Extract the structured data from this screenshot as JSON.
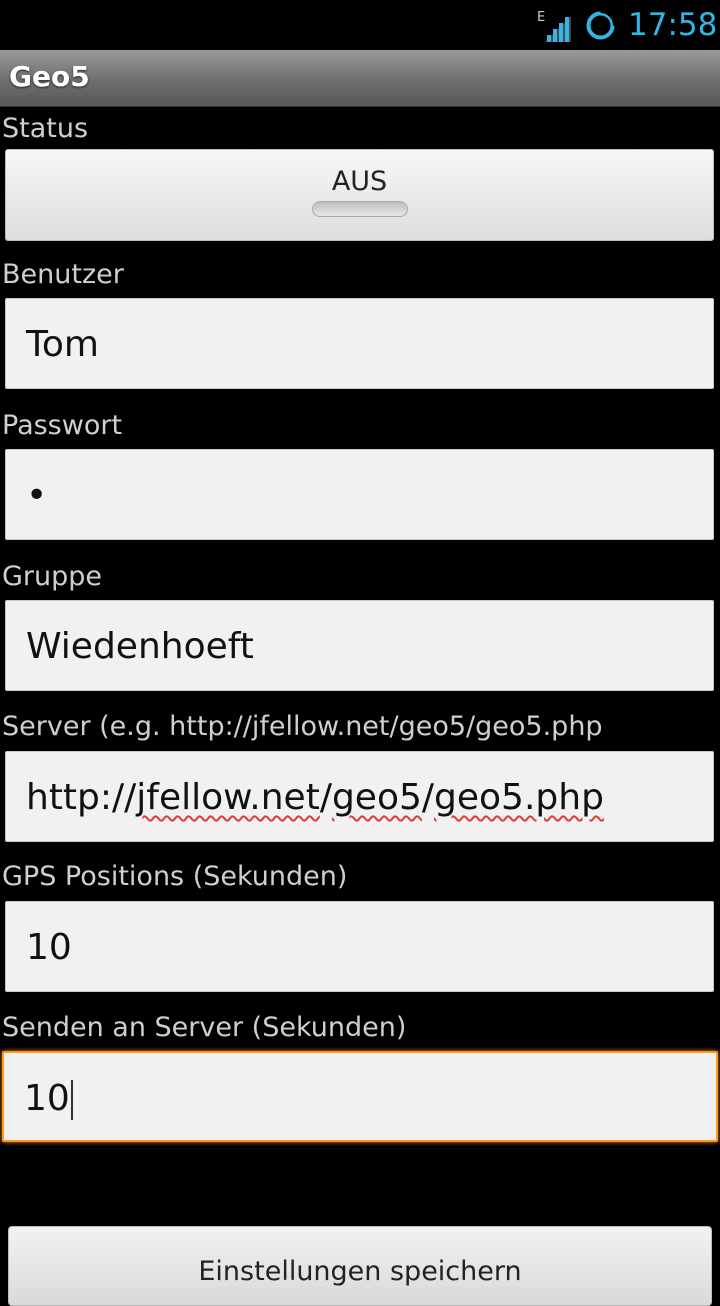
{
  "status_bar": {
    "time": "17:58",
    "network_type": "E",
    "signal_icon": "signal-bars-icon",
    "sync_icon": "sync-ring-icon",
    "accent_color": "#33b5e5"
  },
  "app": {
    "title": "Geo5"
  },
  "form": {
    "status": {
      "label": "Status",
      "toggle_label": "AUS"
    },
    "user": {
      "label": "Benutzer",
      "value": "Tom"
    },
    "password": {
      "label": "Passwort",
      "value": "•"
    },
    "group": {
      "label": "Gruppe",
      "value": "Wiedenhoeft"
    },
    "server": {
      "label": "Server (e.g. http://jfellow.net/geo5/geo5.php",
      "value_prefix": "http://",
      "value_parts": [
        "jfellow.net",
        "/",
        "geo5",
        "/",
        "geo5.php"
      ]
    },
    "gps_interval": {
      "label": "GPS Positions (Sekunden)",
      "value": "10"
    },
    "send_interval": {
      "label": "Senden an Server (Sekunden)",
      "value": "10"
    },
    "save_label": "Einstellungen speichern"
  }
}
